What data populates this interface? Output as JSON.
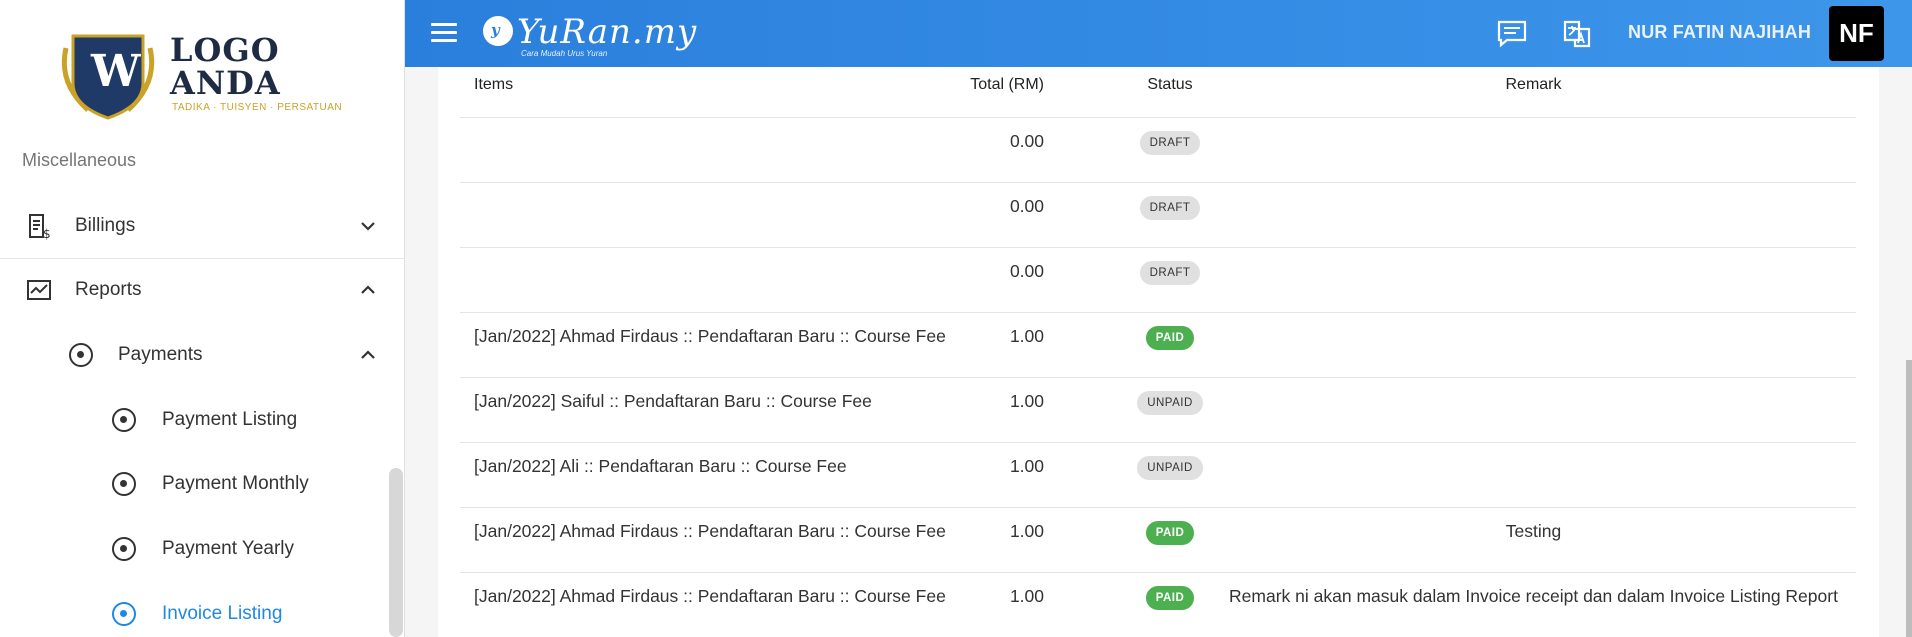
{
  "sidebar": {
    "logo": {
      "main_text_1": "LOGO",
      "main_text_2": "ANDA",
      "letter": "W",
      "tagline": "TADIKA · TUISYEN · PERSATUAN"
    },
    "section_label": "Miscellaneous",
    "items": [
      {
        "label": "Billings",
        "icon": "billing-icon",
        "expanded": false
      },
      {
        "label": "Reports",
        "icon": "reports-icon",
        "expanded": true
      },
      {
        "label": "Payments",
        "icon": "radio-icon",
        "expanded": true
      },
      {
        "label": "Payment Listing",
        "icon": "radio-icon"
      },
      {
        "label": "Payment Monthly",
        "icon": "radio-icon"
      },
      {
        "label": "Payment Yearly",
        "icon": "radio-icon"
      },
      {
        "label": "Invoice Listing",
        "icon": "radio-icon",
        "active": true
      }
    ]
  },
  "topbar": {
    "brand_title": "YuRan.my",
    "brand_letter": "y",
    "brand_tagline": "Cara Mudah Urus Yuran",
    "user_name": "NUR FATIN NAJIHAH",
    "avatar_initials": "NF",
    "icons": [
      "chat-icon",
      "translate-icon"
    ]
  },
  "table": {
    "headers": {
      "items": "Items",
      "total": "Total (RM)",
      "status": "Status",
      "remark": "Remark"
    },
    "rows": [
      {
        "item": "",
        "total": "0.00",
        "status": "DRAFT",
        "remark": ""
      },
      {
        "item": "",
        "total": "0.00",
        "status": "DRAFT",
        "remark": ""
      },
      {
        "item": "",
        "total": "0.00",
        "status": "DRAFT",
        "remark": ""
      },
      {
        "item": "[Jan/2022] Ahmad Firdaus :: Pendaftaran Baru :: Course Fee",
        "total": "1.00",
        "status": "PAID",
        "remark": ""
      },
      {
        "item": "[Jan/2022] Saiful :: Pendaftaran Baru :: Course Fee",
        "total": "1.00",
        "status": "UNPAID",
        "remark": ""
      },
      {
        "item": "[Jan/2022] Ali :: Pendaftaran Baru :: Course Fee",
        "total": "1.00",
        "status": "UNPAID",
        "remark": ""
      },
      {
        "item": "[Jan/2022] Ahmad Firdaus :: Pendaftaran Baru :: Course Fee",
        "total": "1.00",
        "status": "PAID",
        "remark": "Testing"
      },
      {
        "item": "[Jan/2022] Ahmad Firdaus :: Pendaftaran Baru :: Course Fee",
        "total": "1.00",
        "status": "PAID",
        "remark": "Remark ni akan masuk dalam Invoice receipt dan dalam Invoice Listing Report"
      }
    ]
  },
  "colors": {
    "accent": "#1e88e5",
    "topbar": "#3d96ea",
    "paid": "#4caf50",
    "chip_gray": "#e0e0e0"
  }
}
